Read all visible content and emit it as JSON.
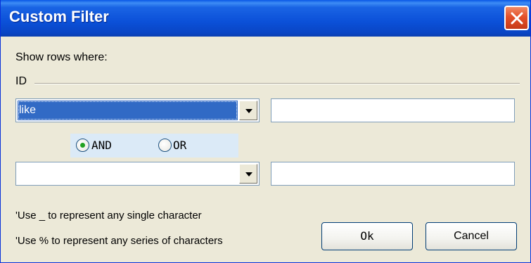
{
  "window": {
    "title": "Custom Filter"
  },
  "filter": {
    "intro_label": "Show rows where:",
    "field_name": "ID",
    "condition1": {
      "operator": "like",
      "value": ""
    },
    "logic": {
      "and_label": "AND",
      "or_label": "OR",
      "selected": "AND"
    },
    "condition2": {
      "operator": "",
      "value": ""
    }
  },
  "hints": {
    "single_char": "'Use _ to represent any single character",
    "series_chars": "'Use % to represent any series of characters"
  },
  "buttons": {
    "ok_label": "Ok",
    "cancel_label": "Cancel"
  },
  "icons": {
    "close": "close-icon",
    "dropdown": "chevron-down-icon"
  }
}
